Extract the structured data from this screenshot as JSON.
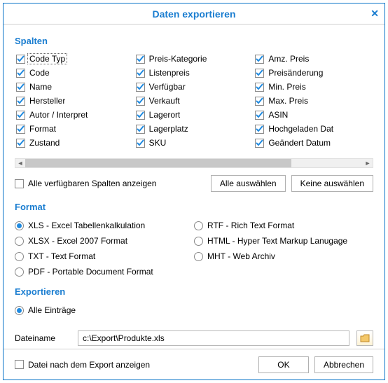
{
  "title": "Daten exportieren",
  "sections": {
    "columns": "Spalten",
    "format": "Format",
    "export": "Exportieren"
  },
  "columns": {
    "col1": [
      "Code Typ",
      "Code",
      "Name",
      "Hersteller",
      "Autor / Interpret",
      "Format",
      "Zustand"
    ],
    "col2": [
      "Preis-Kategorie",
      "Listenpreis",
      "Verfügbar",
      "Verkauft",
      "Lagerort",
      "Lagerplatz",
      "SKU"
    ],
    "col3": [
      "Amz. Preis",
      "Preisänderung",
      "Min. Preis",
      "Max. Preis",
      "ASIN",
      "Hochgeladen Dat",
      "Geändert Datum"
    ]
  },
  "show_all_columns": "Alle verfügbaren Spalten anzeigen",
  "select_all": "Alle auswählen",
  "select_none": "Keine auswählen",
  "formats": {
    "left": [
      {
        "id": "xls",
        "label": "XLS - Excel Tabellenkalkulation",
        "checked": true
      },
      {
        "id": "xlsx",
        "label": "XLSX - Excel 2007 Format",
        "checked": false
      },
      {
        "id": "txt",
        "label": "TXT - Text Format",
        "checked": false
      },
      {
        "id": "pdf",
        "label": "PDF - Portable Document Format",
        "checked": false
      }
    ],
    "right": [
      {
        "id": "rtf",
        "label": "RTF - Rich Text Format",
        "checked": false
      },
      {
        "id": "html",
        "label": "HTML - Hyper Text Markup Lanugage",
        "checked": false
      },
      {
        "id": "mht",
        "label": "MHT - Web Archiv",
        "checked": false
      }
    ]
  },
  "export_all": "Alle Einträge",
  "filename_label": "Dateiname",
  "filename_value": "c:\\Export\\Produkte.xls",
  "show_after_export": "Datei nach dem Export anzeigen",
  "ok": "OK",
  "cancel": "Abbrechen"
}
